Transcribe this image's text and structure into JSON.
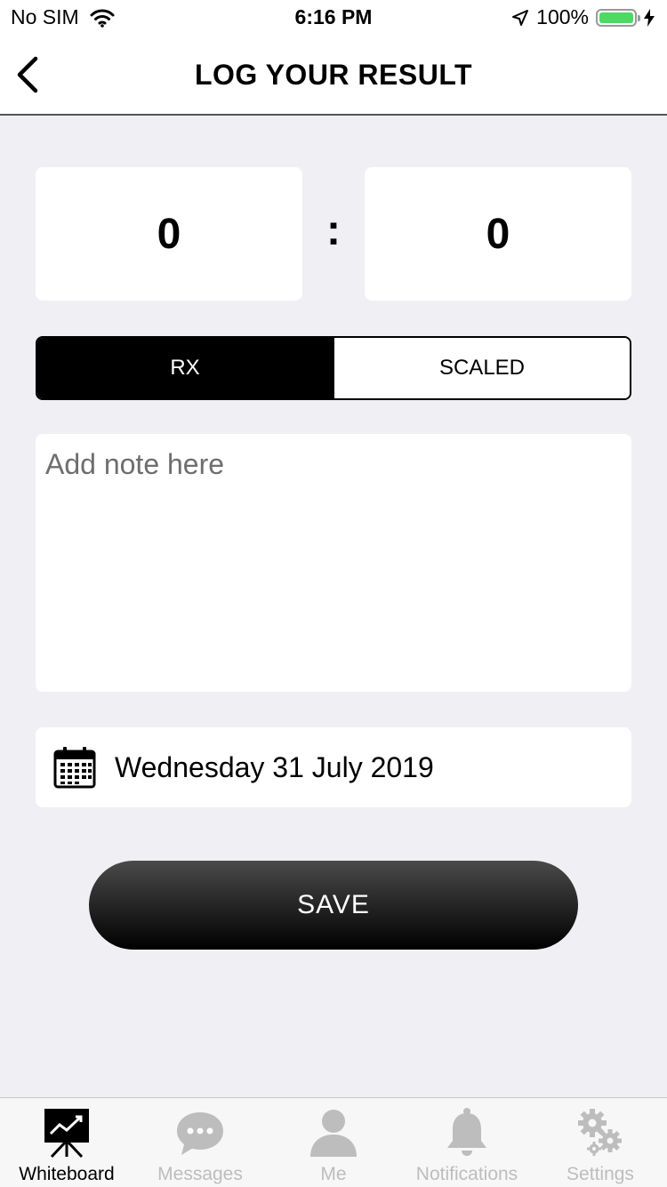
{
  "status_bar": {
    "carrier": "No SIM",
    "time": "6:16 PM",
    "battery_percent": "100%",
    "battery_level": 1.0
  },
  "nav": {
    "title": "LOG YOUR RESULT",
    "back_icon": "chevron-left-icon"
  },
  "result": {
    "minutes": "0",
    "separator": ":",
    "seconds": "0"
  },
  "scale_toggle": {
    "options": [
      "RX",
      "SCALED"
    ],
    "selected": "RX"
  },
  "note": {
    "placeholder": "Add note here",
    "value": ""
  },
  "date": {
    "icon": "calendar-icon",
    "value": "Wednesday 31 July 2019"
  },
  "save_label": "SAVE",
  "tabs": [
    {
      "label": "Whiteboard",
      "icon": "whiteboard-icon",
      "active": true
    },
    {
      "label": "Messages",
      "icon": "chat-bubble-icon",
      "active": false
    },
    {
      "label": "Me",
      "icon": "person-icon",
      "active": false
    },
    {
      "label": "Notifications",
      "icon": "bell-icon",
      "active": false
    },
    {
      "label": "Settings",
      "icon": "gears-icon",
      "active": false
    }
  ],
  "colors": {
    "background": "#efeff4",
    "accent": "#000000",
    "battery": "#4cd964",
    "tab_inactive": "#bdbdbd"
  }
}
